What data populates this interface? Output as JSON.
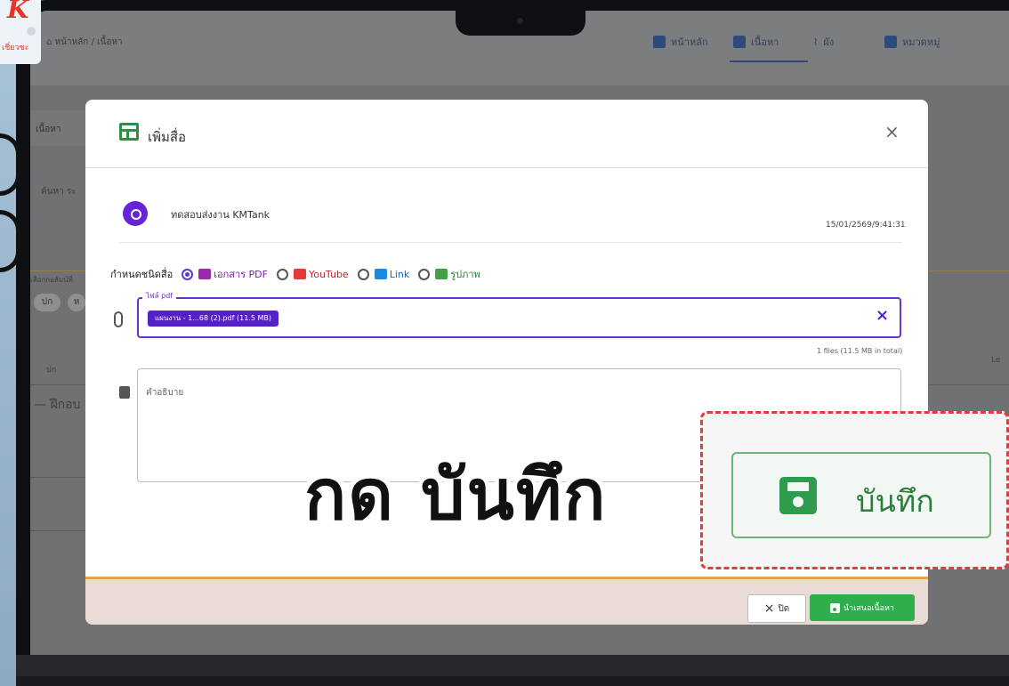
{
  "logo": {
    "letter": "K",
    "small_text": "เชี่ยวชะ"
  },
  "header": {
    "breadcrumb_home": "หน้าหลัก",
    "breadcrumb_sep": "/",
    "breadcrumb_current": "เนื้อหา",
    "nav": [
      "หน้าหลัก",
      "เนื้อหา",
      "ผัง",
      "หมวดหมู่"
    ]
  },
  "background": {
    "side_tab": "เนื้อหา",
    "search_label": "ค้นหา ระ",
    "select_label": "เลือกกอลัมน์ที่",
    "pill_1": "ปก",
    "pill_2": "ห",
    "col_label": "ปก",
    "col_label_right": "Le",
    "row_label": "— ฝึกอบ"
  },
  "modal": {
    "title": "เพิ่มสื่อ",
    "close": "×",
    "user_name": "ทดสอบส่งงาน KMTank",
    "timestamp": "15/01/2569/9:41:31",
    "type_label": "กำหนดชนิดสื่อ",
    "types": [
      {
        "label": "เอกสาร PDF",
        "color": "#9c27b0",
        "selected": true
      },
      {
        "label": "YouTube",
        "color": "#e53935",
        "selected": false
      },
      {
        "label": "Link",
        "color": "#1e88e5",
        "selected": false
      },
      {
        "label": "รูปภาพ",
        "color": "#43a047",
        "selected": false
      }
    ],
    "file_label": "ไฟล์ pdf",
    "file_chip": "แผนงาน - 1...68 (2).pdf (11.5 MB)",
    "file_clear": "×",
    "file_count": "1 files (11.5 MB in total)",
    "description_placeholder": "คำอธิบาย",
    "cancel_label": "ปิด",
    "cancel_icon": "×",
    "submit_label": "นำเสนอเนื้อหา"
  },
  "annotation": {
    "caption": "กด บันทึก",
    "zoom_button_label": "บันทึก",
    "highlight_color": "#e53b3b"
  }
}
